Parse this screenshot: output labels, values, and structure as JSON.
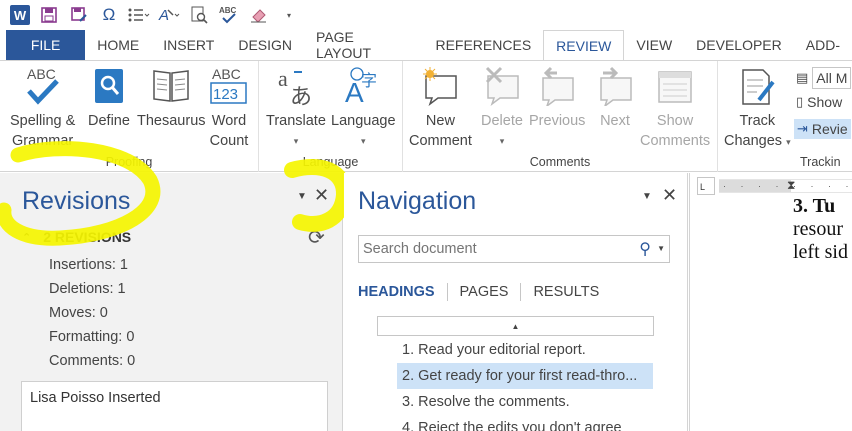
{
  "qat": {
    "app_icon": "word-logo",
    "logo_letter": "W",
    "icons": [
      "save-icon",
      "save-as-icon",
      "symbol-omega-icon",
      "bullets-icon",
      "font-color-icon",
      "print-preview-icon",
      "spelling-abc-icon",
      "eraser-icon",
      "customize-caret-icon"
    ]
  },
  "tabs": {
    "file": "FILE",
    "items": [
      "HOME",
      "INSERT",
      "DESIGN",
      "PAGE LAYOUT",
      "REFERENCES",
      "REVIEW",
      "VIEW",
      "DEVELOPER",
      "ADD-"
    ],
    "active": "REVIEW"
  },
  "ribbon": {
    "proofing": {
      "label": "Proofing",
      "spelling_line1": "Spelling &",
      "spelling_line2": "Grammar",
      "define": "Define",
      "thesaurus": "Thesaurus",
      "word_count_line1": "Word",
      "word_count_line2": "Count",
      "abc": "ABC",
      "abc123": "123"
    },
    "language": {
      "label": "Language",
      "translate": "Translate",
      "language": "Language"
    },
    "comments": {
      "label": "Comments",
      "new_line1": "New",
      "new_line2": "Comment",
      "delete": "Delete",
      "previous": "Previous",
      "next": "Next",
      "show_line1": "Show",
      "show_line2": "Comments"
    },
    "tracking": {
      "label": "Trackin",
      "track_line1": "Track",
      "track_line2": "Changes",
      "all_markup": "All M",
      "show": "Show",
      "review": "Revie"
    }
  },
  "revisions_pane": {
    "title": "Revisions",
    "count": "2 REVISIONS",
    "stats": [
      "Insertions: 1",
      "Deletions: 1",
      "Moves: 0",
      "Formatting: 0",
      "Comments: 0"
    ],
    "entry": "Lisa Poisso Inserted"
  },
  "navigation_pane": {
    "title": "Navigation",
    "search_placeholder": "Search document",
    "tabs": [
      "HEADINGS",
      "PAGES",
      "RESULTS"
    ],
    "active_tab": "HEADINGS",
    "headings": [
      "1. Read your editorial report.",
      "2. Get ready for your first read-thro...",
      "3. Resolve the comments.",
      "4. Reject the edits you don't agree"
    ],
    "selected_index": 1
  },
  "document": {
    "ruler_corner": "L",
    "lines": [
      "3. Tu",
      "resour",
      "left sid"
    ]
  },
  "colors": {
    "accent": "#2b579a",
    "highlighter": "#f5f500",
    "selection": "#cde2f7",
    "pane_bg": "#f2f2f2"
  }
}
